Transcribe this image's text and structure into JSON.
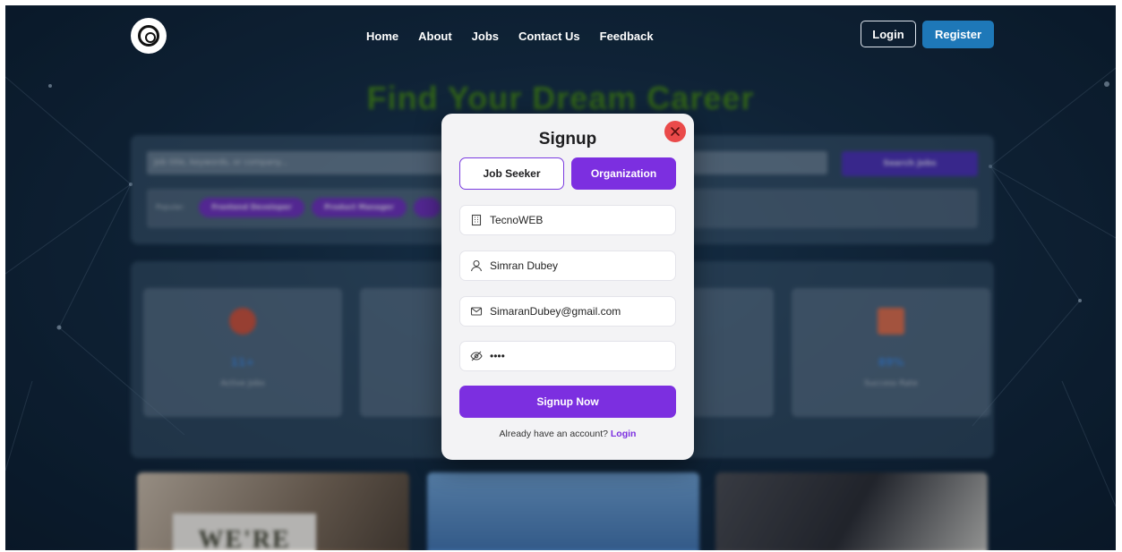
{
  "nav": {
    "links": [
      "Home",
      "About",
      "Jobs",
      "Contact Us",
      "Feedback"
    ],
    "login_label": "Login",
    "register_label": "Register"
  },
  "background": {
    "hero_title": "Find Your Dream Career",
    "search_placeholder": "Job title, keywords, or company...",
    "search_button": "Search Jobs",
    "popular_label": "Popular:",
    "chips": [
      "Frontend Developer",
      "Product Manager"
    ],
    "stats": [
      {
        "value": "11+",
        "label": "Active Jobs",
        "icon": "target-icon"
      },
      {
        "value": "89%",
        "label": "Success Rate",
        "icon": "chart-icon"
      }
    ],
    "photo_text": "WE'RE"
  },
  "modal": {
    "title": "Signup",
    "tabs": {
      "seeker": "Job Seeker",
      "organization": "Organization",
      "active": "organization"
    },
    "fields": {
      "organization": "TecnoWEB",
      "name": "Simran Dubey",
      "email": "SimaranDubey@gmail.com",
      "password": "••••"
    },
    "submit_label": "Signup Now",
    "footer_text": "Already have an account?",
    "footer_link": "Login"
  },
  "colors": {
    "accent": "#7c2fe0",
    "register": "#1e78b8",
    "close": "#ea4a4a",
    "hero": "#3f7d18"
  }
}
